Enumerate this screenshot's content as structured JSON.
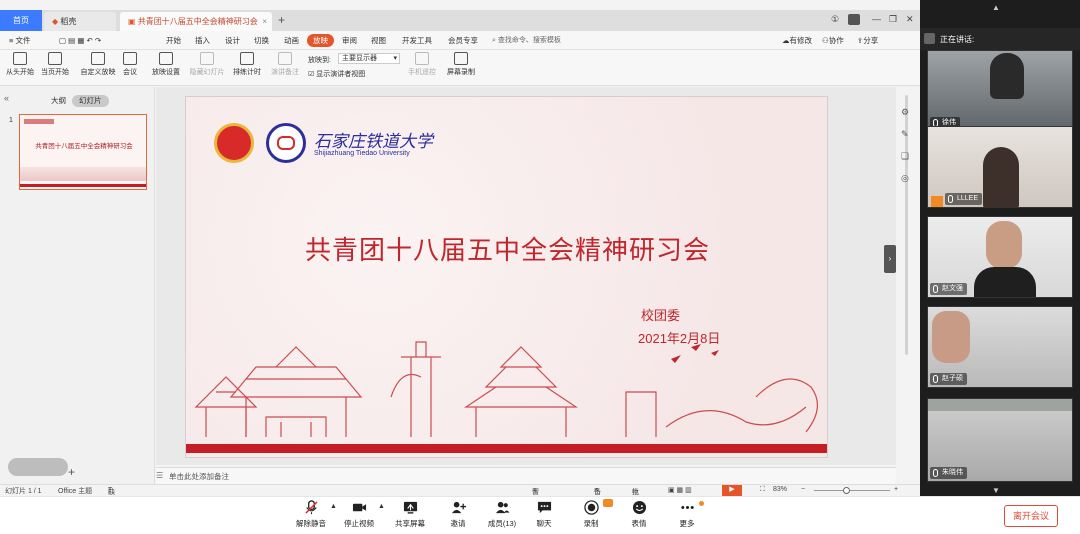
{
  "tabs": {
    "home": "首页",
    "doc1": "稻壳",
    "doc2": "共青团十八届五中全会精神研习会"
  },
  "menu": {
    "file": "文件",
    "start": "开始",
    "insert": "插入",
    "design": "设计",
    "transition": "切换",
    "animation": "动画",
    "slideshow": "放映",
    "review": "审阅",
    "view": "视图",
    "devtools": "开发工具",
    "vip": "会员专享",
    "search": "查找命令、搜索模板",
    "unsaved": "有修改",
    "collab": "协作",
    "share": "分享"
  },
  "ribbon": {
    "from_start": "从头开始",
    "from_current": "当页开始",
    "custom": "自定义放映",
    "meeting": "会议",
    "settings": "放映设置",
    "hide": "隐藏幻灯片",
    "rehearse": "排练计时",
    "narrate": "演讲备注",
    "show_on": "放映到:",
    "monitor": "主要显示器",
    "presenter_view": "显示演讲者视图",
    "phone_remote": "手机遥控",
    "screen_record": "屏幕录制"
  },
  "left_panel": {
    "outline": "大纲",
    "slides": "幻灯片",
    "slide_number": "1",
    "thumb_title": "共青团十八届五中全会精神研习会"
  },
  "slide": {
    "university_cn": "石家庄铁道大学",
    "university_en": "Shijiazhuang Tiedao University",
    "title": "共青团十八届五中全会精神研习会",
    "org": "校团委",
    "date": "2021年2月8日"
  },
  "notes_placeholder": "单击此处添加备注",
  "status": {
    "slide_count": "幻灯片 1 / 1",
    "theme": "Office 主题",
    "missing_font": "缺失字体",
    "beautify": "智能美化",
    "notes": "备注",
    "comments": "批注",
    "zoom": "83%"
  },
  "meeting": {
    "speaking_label": "正在讲话:",
    "participants": [
      {
        "name": "徐伟"
      },
      {
        "name": "LLLEE"
      },
      {
        "name": "赵文强"
      },
      {
        "name": "赵子硕"
      },
      {
        "name": "朱晓伟"
      }
    ],
    "toolbar": {
      "mute": "解除静音",
      "video": "停止视频",
      "share": "共享屏幕",
      "invite": "邀请",
      "members": "成员(13)",
      "chat": "聊天",
      "record": "录制",
      "reactions": "表情",
      "more": "更多",
      "leave": "离开会议"
    }
  },
  "colors": {
    "accent_red": "#c0262b",
    "wps_blue": "#3c7bff",
    "active_menu": "#e4552a"
  }
}
